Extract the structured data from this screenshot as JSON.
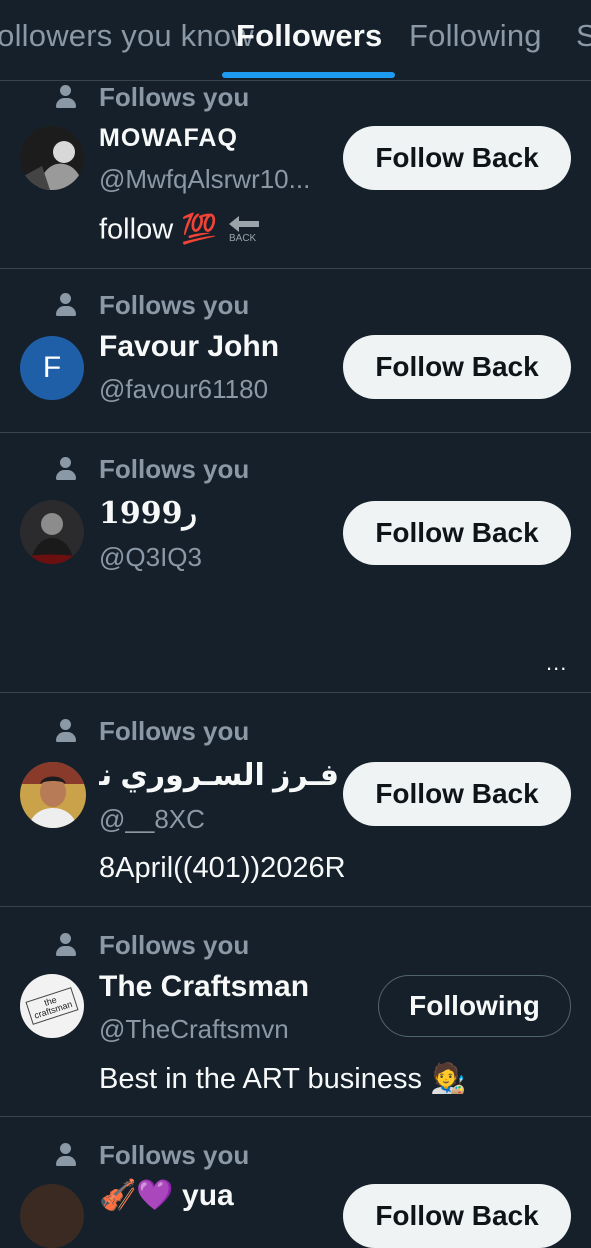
{
  "tabs": [
    {
      "label": "Followers you know",
      "active": false
    },
    {
      "label": "Followers",
      "active": true
    },
    {
      "label": "Following",
      "active": false
    },
    {
      "label": "S",
      "active": false
    }
  ],
  "follows_label": "Follows you",
  "followers": [
    {
      "name": "MOWAFAQ",
      "handle": "@MwfqAlsrwr10...",
      "bio": "follow 💯",
      "bio_icon": "back-arrow-emoji",
      "button": "Follow Back"
    },
    {
      "name": "Favour John",
      "handle": "@favour61180",
      "bio": "",
      "avatar_letter": "F",
      "button": "Follow Back"
    },
    {
      "name": "𝟏𝟗𝟗𝟗ر",
      "handle": "@Q3IQ3",
      "bio": "",
      "button": "Follow Back"
    },
    {
      "name": "فـرز السـروري نشـ...",
      "handle": "@__8XC",
      "bio": "8April((401))2026R",
      "button": "Follow Back"
    },
    {
      "name": "The Craftsman",
      "handle": "@TheCraftsmvn",
      "bio": "Best in the ART business 🧑‍🎨",
      "avatar_text": "the craftsman",
      "button": "Following"
    },
    {
      "name": "🎻💜 yua",
      "handle": "",
      "bio": "",
      "button": "Follow Back"
    }
  ],
  "more_label": "...",
  "colors": {
    "background": "#15202b",
    "accent": "#1d9bf0",
    "muted": "#8b98a5",
    "divider": "#38444d",
    "follow_back_bg": "#eff3f4"
  }
}
